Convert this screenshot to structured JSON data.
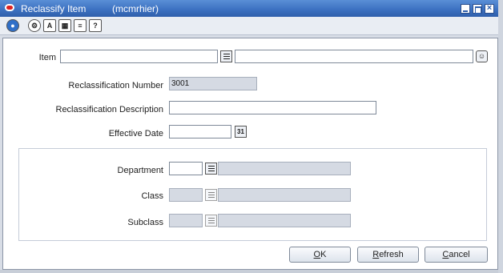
{
  "window": {
    "title": "Reclassify Item",
    "user": "(mcmrhier)"
  },
  "toolbar": {
    "icons": [
      "globe-icon",
      "help-about-icon",
      "spell-check-icon",
      "calendar-grid-icon",
      "list-icon",
      "question-icon"
    ]
  },
  "form": {
    "item_label": "Item",
    "item_value": "",
    "item_desc_value": "",
    "reclass_number_label": "Reclassification Number",
    "reclass_number_value": "3001",
    "reclass_desc_label": "Reclassification Description",
    "reclass_desc_value": "",
    "effective_date_label": "Effective Date",
    "effective_date_value": "",
    "department_label": "Department",
    "department_value": "",
    "department_desc": "",
    "class_label": "Class",
    "class_value": "",
    "class_desc": "",
    "subclass_label": "Subclass",
    "subclass_value": "",
    "subclass_desc": ""
  },
  "buttons": {
    "ok": {
      "prefix": "",
      "key": "O",
      "rest": "K"
    },
    "refresh": {
      "prefix": "",
      "key": "R",
      "rest": "efresh"
    },
    "cancel": {
      "prefix": "",
      "key": "C",
      "rest": "ancel"
    }
  }
}
